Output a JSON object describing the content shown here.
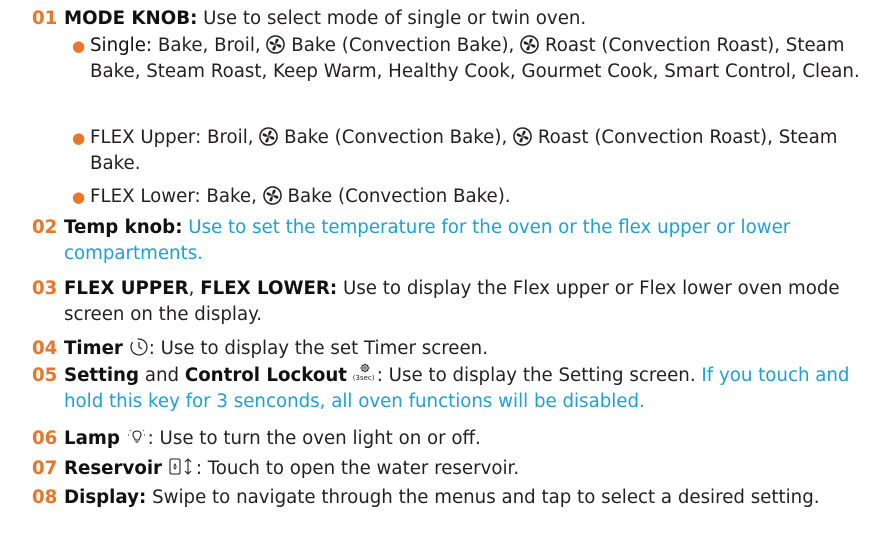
{
  "items": [
    {
      "num": "01",
      "title": "MODE KNOB",
      "sep": ":",
      "text": "Use to select mode of single or twin oven.",
      "subs": [
        {
          "label": "Single:",
          "t1": "Bake, Broil,",
          "t2": "Bake (Convection Bake),",
          "t3": "Roast (Convection Roast), Steam Bake, Steam Roast, Keep Warm, Healthy Cook, Gourmet Cook, Smart Control, Clean."
        },
        {
          "label": "FLEX Upper:",
          "t1": "Broil,",
          "t2": "Bake (Convection Bake),",
          "t3": "Roast (Convection Roast), Steam Bake."
        },
        {
          "label": "FLEX Lower:",
          "t1": "Bake,",
          "t2": "Bake (Convection Bake)."
        }
      ]
    },
    {
      "num": "02",
      "title": "Temp knob",
      "sep": ":",
      "note": "Use to set the temperature for the oven or the flex upper or lower compartments."
    },
    {
      "num": "03",
      "title": "FLEX UPPER",
      "joiner": ",",
      "title2": "FLEX LOWER:",
      "text": "Use to display the Flex upper or Flex lower oven mode screen on the display."
    },
    {
      "num": "04",
      "title": "Timer",
      "text": ": Use to display the set Timer screen."
    },
    {
      "num": "05",
      "title": "Setting",
      "joiner": "and",
      "title2": "Control Lockout",
      "icon_sub": "(3sec)",
      "text": ": Use to display the Setting screen.",
      "note": "If you touch and hold this key for 3 senconds, all oven functions will be disabled."
    },
    {
      "num": "06",
      "title": "Lamp",
      "text": ": Use to turn the oven light on or off."
    },
    {
      "num": "07",
      "title": "Reservoir",
      "text": ": Touch to open the water reservoir."
    },
    {
      "num": "08",
      "title": "Display",
      "sep": ":",
      "text": "Swipe to navigate through the menus and tap to select a desired setting."
    }
  ],
  "icons": {
    "fan": "convection-fan-icon",
    "timer": "timer-clock-icon",
    "settings": "gear-lock-icon",
    "lamp": "lamp-bulb-icon",
    "reservoir": "reservoir-icon"
  },
  "colors": {
    "number": "#e8762b",
    "note": "#1ba1d6",
    "text": "#231f20"
  }
}
